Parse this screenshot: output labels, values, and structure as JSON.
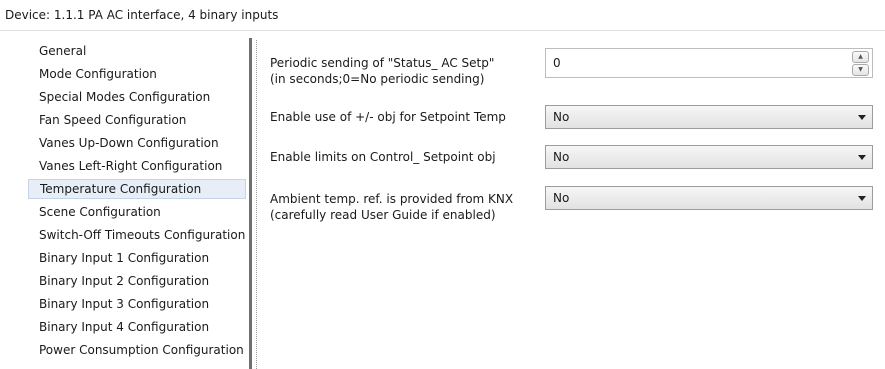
{
  "header": {
    "title": "Device: 1.1.1  PA AC interface, 4 binary inputs"
  },
  "sidebar": {
    "items": [
      {
        "label": "General"
      },
      {
        "label": "Mode Configuration"
      },
      {
        "label": "Special Modes Configuration"
      },
      {
        "label": "Fan Speed Configuration"
      },
      {
        "label": "Vanes Up-Down Configuration"
      },
      {
        "label": "Vanes Left-Right Configuration"
      },
      {
        "label": "Temperature Configuration"
      },
      {
        "label": "Scene Configuration"
      },
      {
        "label": "Switch-Off Timeouts Configuration"
      },
      {
        "label": "Binary Input 1 Configuration"
      },
      {
        "label": "Binary Input 2 Configuration"
      },
      {
        "label": "Binary Input 3 Configuration"
      },
      {
        "label": "Binary Input 4 Configuration"
      },
      {
        "label": "Power Consumption Configuration"
      }
    ],
    "selected": "Temperature Configuration"
  },
  "settings": {
    "periodic_sending": {
      "label_line1": "Periodic sending of \"Status_ AC Setp\"",
      "label_line2": "(in seconds;0=No periodic sending)",
      "value": "0"
    },
    "enable_pm_obj": {
      "label": "Enable use of +/- obj for Setpoint Temp",
      "value": "No"
    },
    "enable_limits": {
      "label": "Enable limits on Control_ Setpoint obj",
      "value": "No"
    },
    "ambient_ref": {
      "label_line1": "Ambient temp. ref. is provided from KNX",
      "label_line2": "(carefully read User Guide if enabled)",
      "value": "No"
    }
  },
  "colors": {
    "selected_bg": "#e8eef8",
    "selected_border": "#c7d3e6",
    "splitter": "#6f6f6f"
  }
}
